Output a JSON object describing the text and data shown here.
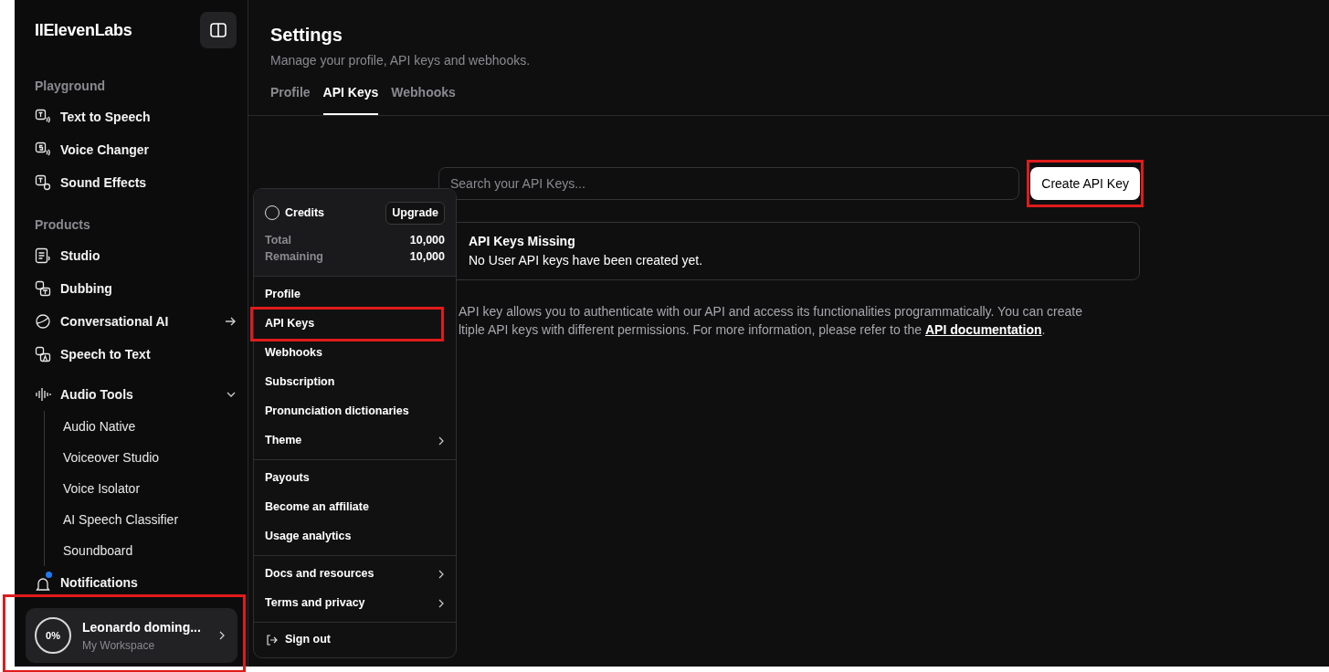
{
  "sidebar": {
    "logo": "IIElevenLabs",
    "sections": [
      {
        "title": "Playground",
        "items": [
          {
            "label": "Text to Speech",
            "kind": "tts",
            "external": false
          },
          {
            "label": "Voice Changer",
            "kind": "voice",
            "external": false
          },
          {
            "label": "Sound Effects",
            "kind": "sfx",
            "external": false
          }
        ]
      },
      {
        "title": "Products",
        "items": [
          {
            "label": "Studio",
            "kind": "studio",
            "external": false
          },
          {
            "label": "Dubbing",
            "kind": "dub",
            "external": false
          },
          {
            "label": "Conversational AI",
            "kind": "chat",
            "external": true
          },
          {
            "label": "Speech to Text",
            "kind": "stt",
            "external": false
          }
        ]
      }
    ],
    "audio_tools": {
      "label": "Audio Tools",
      "expanded": true,
      "children": [
        {
          "label": "Audio Native"
        },
        {
          "label": "Voiceover Studio"
        },
        {
          "label": "Voice Isolator"
        },
        {
          "label": "AI Speech Classifier"
        },
        {
          "label": "Soundboard"
        }
      ]
    },
    "notifications": {
      "label": "Notifications",
      "unread": true
    },
    "user": {
      "usage": "0%",
      "name": "Leonardo doming...",
      "workspace": "My Workspace",
      "highlighted": true
    }
  },
  "menu": {
    "credits_label": "Credits",
    "upgrade": "Upgrade",
    "rows": [
      {
        "label": "Total",
        "value": "10,000"
      },
      {
        "label": "Remaining",
        "value": "10,000"
      }
    ],
    "groups": [
      [
        {
          "label": "Profile",
          "highlighted": false,
          "submenu": false
        },
        {
          "label": "API Keys",
          "highlighted": true,
          "submenu": false
        },
        {
          "label": "Webhooks",
          "highlighted": false,
          "submenu": false
        },
        {
          "label": "Subscription",
          "highlighted": false,
          "submenu": false
        },
        {
          "label": "Pronunciation dictionaries",
          "highlighted": false,
          "submenu": false
        },
        {
          "label": "Theme",
          "highlighted": false,
          "submenu": true
        }
      ],
      [
        {
          "label": "Payouts",
          "highlighted": false,
          "submenu": false
        },
        {
          "label": "Become an affiliate",
          "highlighted": false,
          "submenu": false
        },
        {
          "label": "Usage analytics",
          "highlighted": false,
          "submenu": false
        }
      ],
      [
        {
          "label": "Docs and resources",
          "highlighted": false,
          "submenu": true
        },
        {
          "label": "Terms and privacy",
          "highlighted": false,
          "submenu": true
        }
      ]
    ],
    "sign_out": "Sign out"
  },
  "main": {
    "title": "Settings",
    "subtitle": "Manage your profile, API keys and webhooks.",
    "tabs": [
      {
        "label": "Profile",
        "selected": false
      },
      {
        "label": "API Keys",
        "selected": true
      },
      {
        "label": "Webhooks",
        "selected": false
      }
    ],
    "search": {
      "placeholder": "Search your API Keys..."
    },
    "create_button": {
      "label": "Create API Key",
      "highlighted": true
    },
    "empty_state": {
      "title": "API Keys Missing",
      "message": "No User API keys have been created yet."
    },
    "description": {
      "line_1": "API key allows you to authenticate with our API and access its functionalities programmatically. You can create",
      "line_2": "ltiple API keys with different permissions. For more information, please refer to the ",
      "link": "API documentation",
      "end": "."
    }
  }
}
